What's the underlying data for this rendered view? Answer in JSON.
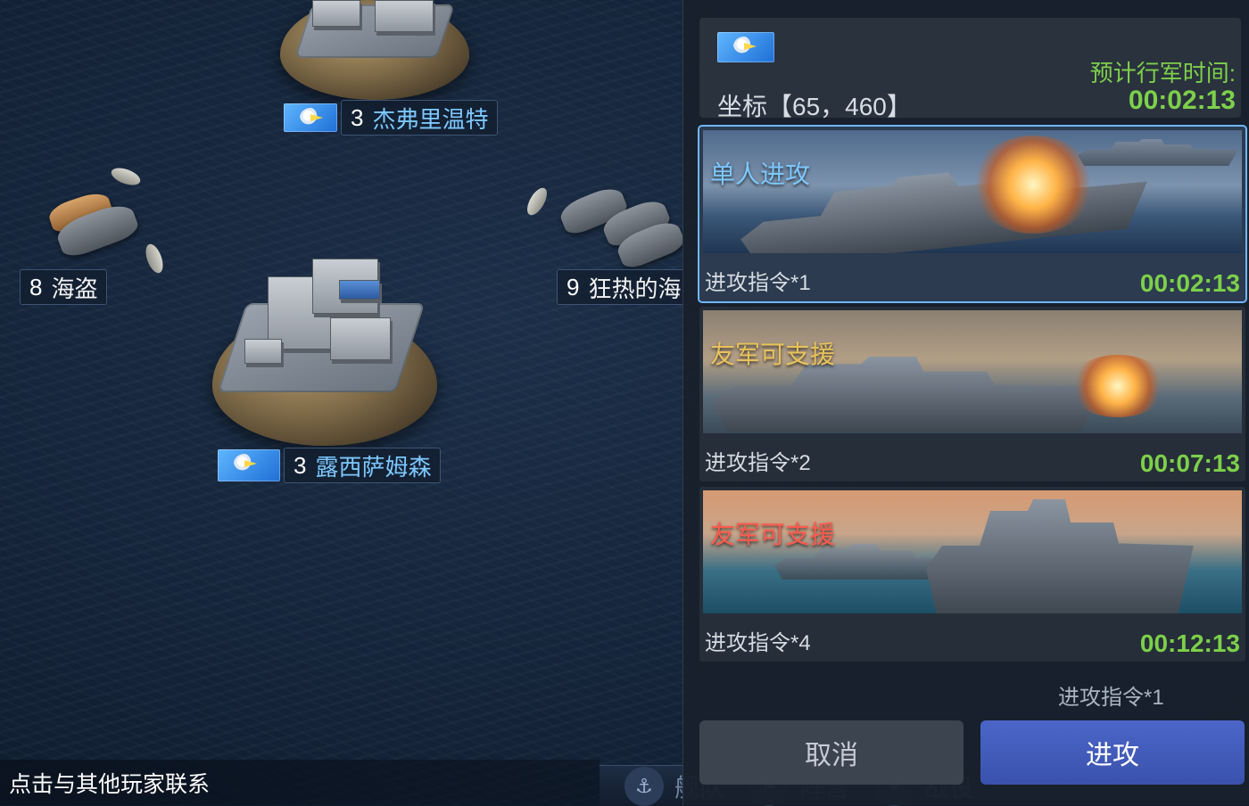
{
  "map": {
    "labels": [
      {
        "id": "jeffrey",
        "level": "3",
        "name": "杰弗里温特",
        "has_flag": true
      },
      {
        "id": "pirate",
        "level": "8",
        "name": "海盗",
        "has_flag": false
      },
      {
        "id": "zealot",
        "level": "9",
        "name": "狂热的海",
        "has_flag": false
      },
      {
        "id": "lucy",
        "level": "3",
        "name": "露西萨姆森",
        "has_flag": true
      }
    ]
  },
  "contact_hint": "点击与其他玩家联系",
  "bottom_nav": {
    "items": [
      {
        "label": "舰队",
        "icon": "fleet-icon"
      },
      {
        "label": "阵营",
        "icon": "faction-icon"
      },
      {
        "label": "战役",
        "icon": "campaign-icon"
      }
    ]
  },
  "panel": {
    "coord_label": "坐标【65，460】",
    "march_label": "预计行军时间:",
    "march_time": "00:02:13",
    "options": [
      {
        "title": "单人进攻",
        "title_color": "#7cc8ff",
        "command": "进攻指令*1",
        "time": "00:02:13",
        "selected": true
      },
      {
        "title": "友军可支援",
        "title_color": "#e8c25a",
        "command": "进攻指令*2",
        "time": "00:07:13",
        "selected": false
      },
      {
        "title": "友军可支援",
        "title_color": "#ff5a4e",
        "command": "进攻指令*4",
        "time": "00:12:13",
        "selected": false
      }
    ],
    "cost_label": "进攻指令*1",
    "cancel_label": "取消",
    "attack_label": "进攻"
  },
  "colors": {
    "time_green": "#7dd04a",
    "attack_blue": "#4b66c8",
    "label_blue": "#7cc8ff"
  }
}
